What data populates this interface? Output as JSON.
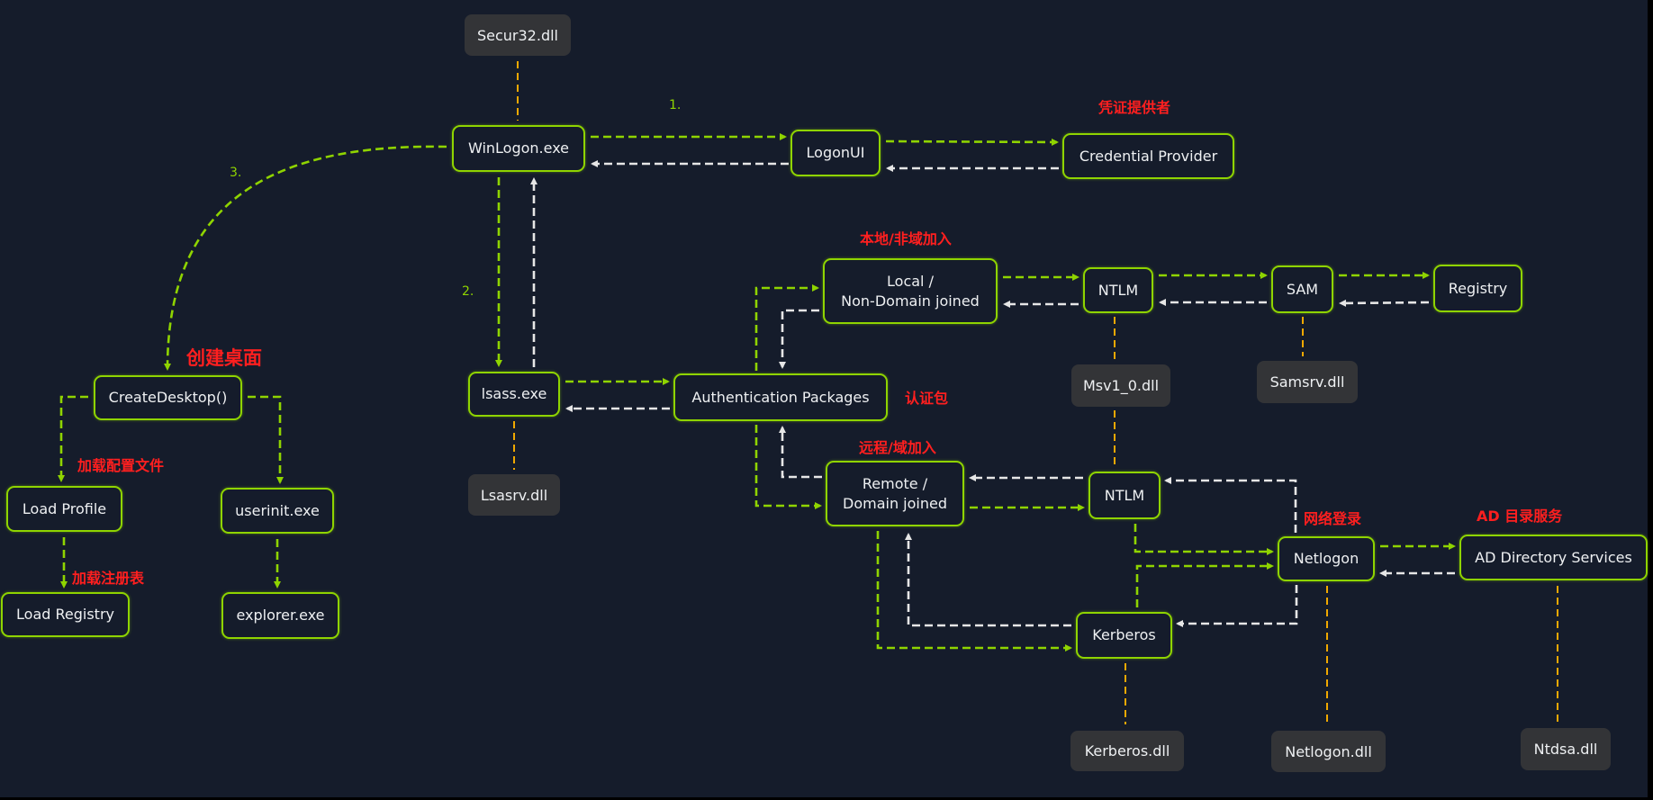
{
  "nodes": {
    "winlogon": "WinLogon.exe",
    "logonui": "LogonUI",
    "credential_provider": "Credential Provider",
    "lsass": "lsass.exe",
    "auth_packages": "Authentication Packages",
    "local_non_domain": "Local /\nNon-Domain joined",
    "remote_domain": "Remote /\nDomain joined",
    "ntlm_local": "NTLM",
    "sam": "SAM",
    "registry": "Registry",
    "ntlm_remote": "NTLM",
    "kerberos": "Kerberos",
    "netlogon": "Netlogon",
    "ad_directory_services": "AD Directory Services",
    "create_desktop": "CreateDesktop()",
    "load_profile": "Load Profile",
    "load_registry": "Load Registry",
    "userinit": "userinit.exe",
    "explorer": "explorer.exe"
  },
  "dlls": {
    "secur32": "Secur32.dll",
    "lsasrv": "Lsasrv.dll",
    "msv1_0": "Msv1_0.dll",
    "samsrv": "Samsrv.dll",
    "kerberos": "Kerberos.dll",
    "netlogon": "Netlogon.dll",
    "ntdsa": "Ntdsa.dll"
  },
  "annotations": {
    "credential_provider": "凭证提供者",
    "local_non_domain": "本地/非域加入",
    "auth_packages": "认证包",
    "remote_domain": "远程/域加入",
    "netlogon": "网络登录",
    "ad_directory_services": "AD 目录服务",
    "create_desktop": "创建桌面",
    "load_profile": "加载配置文件",
    "load_registry": "加载注册表"
  },
  "steps": {
    "step1": "1.",
    "step2": "2.",
    "step3": "3."
  },
  "colors": {
    "background": "#151c2b",
    "node_border": "#8fd400",
    "request_arrow": "#8fd400",
    "response_arrow": "#e6e6e6",
    "dll_link": "#f0a800",
    "dll_fill": "#333437",
    "annotation": "#ff1f1f"
  }
}
